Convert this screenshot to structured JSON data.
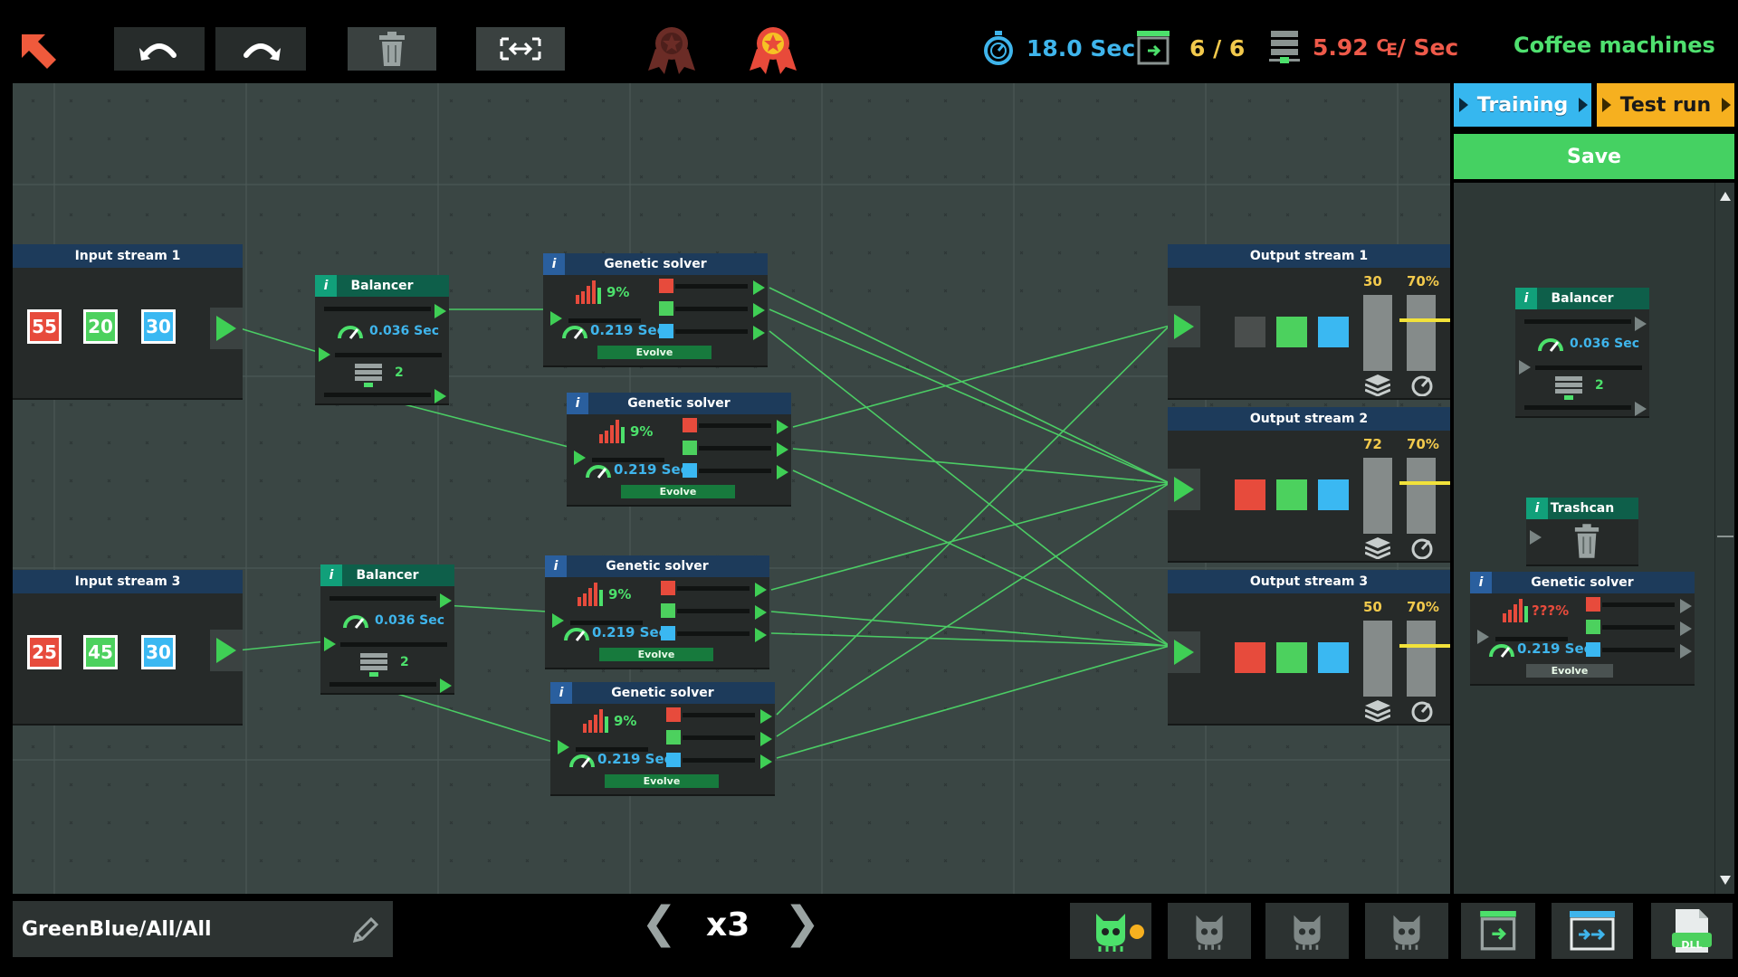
{
  "topbar": {
    "time": "18.0 Sec",
    "progress": "6 / 6",
    "cost": "5.92 ₠/ Sec",
    "level_title": "Coffee machines",
    "colors": {
      "time": "#3fb5ec",
      "progress": "#f2c94c",
      "cost": "#ef5a4a",
      "title": "#4fe06f"
    },
    "icons": [
      "back-arrow-icon",
      "undo-icon",
      "redo-icon",
      "trash-icon",
      "fit-icon",
      "medal-locked-icon",
      "medal-earned-icon",
      "stopwatch-icon",
      "board-icon",
      "server-icon"
    ]
  },
  "inputs": [
    {
      "title": "Input stream 1",
      "values": [
        "55",
        "20",
        "30"
      ]
    },
    {
      "title": "Input stream 3",
      "values": [
        "25",
        "45",
        "30"
      ]
    }
  ],
  "balancers": [
    {
      "title": "Balancer",
      "speed": "0.036 Sec",
      "count": "2"
    },
    {
      "title": "Balancer",
      "speed": "0.036 Sec",
      "count": "2"
    }
  ],
  "solvers": [
    {
      "title": "Genetic solver",
      "pct": "9%",
      "speed": "0.219 Sec",
      "button": "Evolve"
    },
    {
      "title": "Genetic solver",
      "pct": "9%",
      "speed": "0.219 Sec",
      "button": "Evolve"
    },
    {
      "title": "Genetic solver",
      "pct": "9%",
      "speed": "0.219 Sec",
      "button": "Evolve"
    },
    {
      "title": "Genetic solver",
      "pct": "9%",
      "speed": "0.219 Sec",
      "button": "Evolve"
    }
  ],
  "outputs": [
    {
      "title": "Output stream 1",
      "count": "30",
      "target": "70%",
      "colors": [
        "#4a4e4d",
        "#4cd15e",
        "#3ab8f2"
      ]
    },
    {
      "title": "Output stream 2",
      "count": "72",
      "target": "70%",
      "colors": [
        "#e74b3c",
        "#4cd15e",
        "#3ab8f2"
      ]
    },
    {
      "title": "Output stream 3",
      "count": "50",
      "target": "70%",
      "colors": [
        "#e74b3c",
        "#4cd15e",
        "#3ab8f2"
      ]
    }
  ],
  "side": {
    "tab_training": "Training",
    "tab_testrun": "Test run",
    "save": "Save",
    "palette": {
      "balancer": {
        "title": "Balancer",
        "speed": "0.036 Sec",
        "count": "2"
      },
      "trashcan": {
        "title": "Trashcan"
      },
      "solver": {
        "title": "Genetic solver",
        "pct": "???%",
        "speed": "0.219 Sec",
        "button": "Evolve"
      }
    }
  },
  "bottom": {
    "filter": "GreenBlue/All/All",
    "speed": "x3",
    "prev": "❮",
    "next": "❯",
    "icons": [
      "pencil-icon",
      "bot-active-icon",
      "bot-icon",
      "board-icon",
      "transfer-icon",
      "dll-file-icon"
    ],
    "dll_label": "DLL"
  }
}
